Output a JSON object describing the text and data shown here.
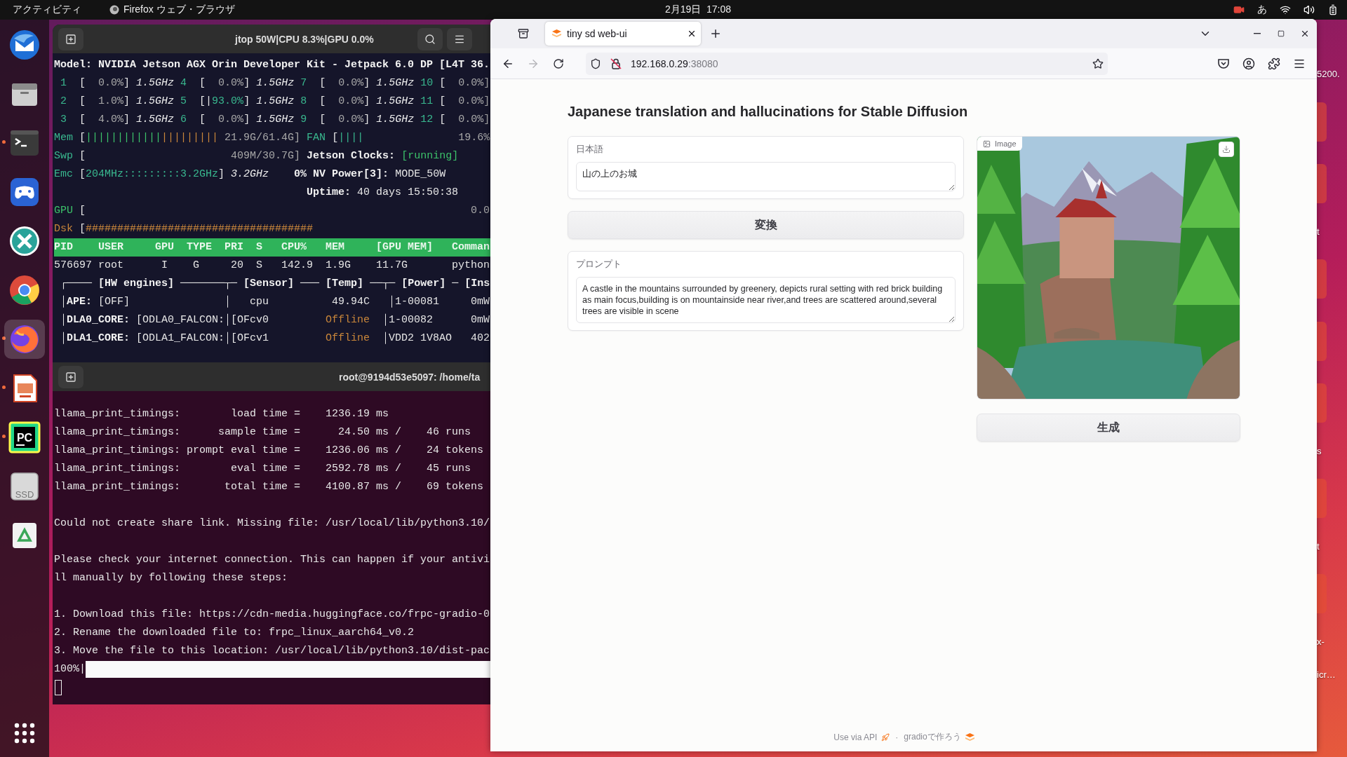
{
  "top_bar": {
    "activities": "アクティビティ",
    "app_name": "Firefox ウェブ・ブラウザ",
    "clock": "2月19日  17:08",
    "input_method": "あ"
  },
  "dock": {
    "items": [
      {
        "kind": "mail",
        "running": false,
        "selected": false
      },
      {
        "kind": "files",
        "running": false,
        "selected": false
      },
      {
        "kind": "terminal",
        "running": true,
        "selected": false
      },
      {
        "kind": "gamepad",
        "running": false,
        "selected": false
      },
      {
        "kind": "remote",
        "running": false,
        "selected": false
      },
      {
        "kind": "chrome",
        "running": false,
        "selected": false
      },
      {
        "kind": "firefox",
        "running": true,
        "selected": true
      },
      {
        "kind": "presentation",
        "running": true,
        "selected": false
      },
      {
        "kind": "ide",
        "label": "PC",
        "running": true,
        "selected": false
      },
      {
        "kind": "drive",
        "label": "SSD",
        "running": false,
        "selected": false
      },
      {
        "kind": "trash",
        "running": false,
        "selected": false
      }
    ]
  },
  "jtop_terminal": {
    "title": "jtop 50W|CPU 8.3%|GPU 0.0%",
    "lines": [
      [
        {
          "text": "Model: NVIDIA Jetson AGX Orin Developer Kit - Jetpack 6.0 DP [L4T 36.",
          "kind": "bold"
        }
      ],
      [
        {
          "text": " 1  ",
          "kind": "label"
        },
        {
          "text": "[  ",
          "kind": "plain"
        },
        {
          "text": "0.0%",
          "kind": "dim"
        },
        {
          "text": "] ",
          "kind": "plain"
        },
        {
          "text": "1.5GHz",
          "kind": "italic"
        },
        {
          "text": " 4  ",
          "kind": "label"
        },
        {
          "text": "[  ",
          "kind": "plain"
        },
        {
          "text": "0.0%",
          "kind": "dim"
        },
        {
          "text": "] ",
          "kind": "plain"
        },
        {
          "text": "1.5GHz",
          "kind": "italic"
        },
        {
          "text": " 7  ",
          "kind": "label"
        },
        {
          "text": "[  ",
          "kind": "plain"
        },
        {
          "text": "0.0%",
          "kind": "dim"
        },
        {
          "text": "] ",
          "kind": "plain"
        },
        {
          "text": "1.5GHz",
          "kind": "italic"
        },
        {
          "text": " 10 ",
          "kind": "label"
        },
        {
          "text": "[  ",
          "kind": "plain"
        },
        {
          "text": "0.0%]",
          "kind": "dim"
        }
      ],
      [
        {
          "text": " 2  ",
          "kind": "label"
        },
        {
          "text": "[  ",
          "kind": "plain"
        },
        {
          "text": "1.0%",
          "kind": "dim"
        },
        {
          "text": "] ",
          "kind": "plain"
        },
        {
          "text": "1.5GHz",
          "kind": "italic"
        },
        {
          "text": " 5  ",
          "kind": "label"
        },
        {
          "text": "[|",
          "kind": "plain"
        },
        {
          "text": "93.0%",
          "kind": "label"
        },
        {
          "text": "] ",
          "kind": "plain"
        },
        {
          "text": "1.5GHz",
          "kind": "italic"
        },
        {
          "text": " 8  ",
          "kind": "label"
        },
        {
          "text": "[  ",
          "kind": "plain"
        },
        {
          "text": "0.0%",
          "kind": "dim"
        },
        {
          "text": "] ",
          "kind": "plain"
        },
        {
          "text": "1.5GHz",
          "kind": "italic"
        },
        {
          "text": " 11 ",
          "kind": "label"
        },
        {
          "text": "[  ",
          "kind": "plain"
        },
        {
          "text": "0.0%]",
          "kind": "dim"
        }
      ],
      [
        {
          "text": " 3  ",
          "kind": "label"
        },
        {
          "text": "[  ",
          "kind": "plain"
        },
        {
          "text": "4.0%",
          "kind": "dim"
        },
        {
          "text": "] ",
          "kind": "plain"
        },
        {
          "text": "1.5GHz",
          "kind": "italic"
        },
        {
          "text": " 6  ",
          "kind": "label"
        },
        {
          "text": "[  ",
          "kind": "plain"
        },
        {
          "text": "0.0%",
          "kind": "dim"
        },
        {
          "text": "] ",
          "kind": "plain"
        },
        {
          "text": "1.5GHz",
          "kind": "italic"
        },
        {
          "text": " 9  ",
          "kind": "label"
        },
        {
          "text": "[  ",
          "kind": "plain"
        },
        {
          "text": "0.0%",
          "kind": "dim"
        },
        {
          "text": "] ",
          "kind": "plain"
        },
        {
          "text": "1.5GHz",
          "kind": "italic"
        },
        {
          "text": " 12 ",
          "kind": "label"
        },
        {
          "text": "[  ",
          "kind": "plain"
        },
        {
          "text": "0.0%]",
          "kind": "dim"
        }
      ],
      [
        {
          "text": "Mem",
          "kind": "label"
        },
        {
          "text": " [",
          "kind": "plain"
        },
        {
          "text": "||||||||||||",
          "kind": "green"
        },
        {
          "text": "|||||||||",
          "kind": "orange"
        },
        {
          "text": " 21.9G/61.4G]",
          "kind": "dim"
        },
        {
          "text": " FAN ",
          "kind": "label"
        },
        {
          "text": "[",
          "kind": "plain"
        },
        {
          "text": "||||",
          "kind": "label"
        },
        {
          "text": "               19.6%",
          "kind": "dim"
        }
      ],
      [
        {
          "text": "Swp",
          "kind": "label"
        },
        {
          "text": " [",
          "kind": "plain"
        },
        {
          "text": "                       409M/30.7G]",
          "kind": "dim"
        },
        {
          "text": " Jetson Clocks: ",
          "kind": "bold"
        },
        {
          "text": "[running]",
          "kind": "green"
        }
      ],
      [
        {
          "text": "Emc",
          "kind": "label"
        },
        {
          "text": " [",
          "kind": "plain"
        },
        {
          "text": "204MHz:::::::::3.2GHz",
          "kind": "label"
        },
        {
          "text": "] ",
          "kind": "plain"
        },
        {
          "text": "3.2GHz",
          "kind": "italic"
        },
        {
          "text": "    0% NV Power[3]: ",
          "kind": "bold"
        },
        {
          "text": "MODE_50W",
          "kind": "plain"
        }
      ],
      [
        {
          "text": "                                        Uptime:",
          "kind": "bold"
        },
        {
          "text": " 40 days 15:50:38",
          "kind": "plain"
        }
      ],
      [
        {
          "text": "GPU",
          "kind": "green"
        },
        {
          "text": " [",
          "kind": "plain"
        },
        {
          "text": "                                                             0.0",
          "kind": "dim"
        }
      ],
      [
        {
          "text": "Dsk",
          "kind": "orange"
        },
        {
          "text": " [",
          "kind": "plain"
        },
        {
          "text": "####################################",
          "kind": "orange"
        }
      ]
    ],
    "table_header": "PID    USER     GPU  TYPE  PRI  S   CPU%   MEM     [GPU MEM]   Comman",
    "table_row": "576697 root      I    G     20  S   142.9  1.9G    11.7G       python",
    "panel_lines": [
      [
        {
          "text": " ┌──── ",
          "kind": "plain"
        },
        {
          "text": "[HW engines]",
          "kind": "bold"
        },
        {
          "text": " ───────┬─ ",
          "kind": "plain"
        },
        {
          "text": "[Sensor]",
          "kind": "bold"
        },
        {
          "text": " ─── ",
          "kind": "plain"
        },
        {
          "text": "[Temp]",
          "kind": "bold"
        },
        {
          "text": " ──┬─ ",
          "kind": "plain"
        },
        {
          "text": "[Power]",
          "kind": "bold"
        },
        {
          "text": " ─ ",
          "kind": "plain"
        },
        {
          "text": "[Ins",
          "kind": "bold"
        }
      ],
      [
        {
          "text": " │",
          "kind": "plain"
        },
        {
          "text": "APE:",
          "kind": "bold"
        },
        {
          "text": " [OFF]               │   cpu          49.94C   │1-00081     0mW",
          "kind": "plain"
        }
      ],
      [
        {
          "text": " │",
          "kind": "plain"
        },
        {
          "text": "DLA0_CORE:",
          "kind": "bold"
        },
        {
          "text": " [ODLA0_FALCON:│[OFcv0         ",
          "kind": "plain"
        },
        {
          "text": "Offline",
          "kind": "orange"
        },
        {
          "text": "  │1-00082      0mW",
          "kind": "plain"
        }
      ],
      [
        {
          "text": " │",
          "kind": "plain"
        },
        {
          "text": "DLA1_CORE:",
          "kind": "bold"
        },
        {
          "text": " [ODLA1_FALCON:│[OFcv1         ",
          "kind": "plain"
        },
        {
          "text": "Offline",
          "kind": "orange"
        },
        {
          "text": "  │VDD2 1V8AO   402",
          "kind": "plain"
        }
      ]
    ]
  },
  "shell_terminal": {
    "title": "root@9194d53e5097: /home/ta",
    "blocks": [
      [
        "llama_print_timings:        load time =    1236.19 ms",
        "llama_print_timings:      sample time =      24.50 ms /    46 runs",
        "llama_print_timings: prompt eval time =    1236.06 ms /    24 tokens",
        "llama_print_timings:        eval time =    2592.78 ms /    45 runs",
        "llama_print_timings:       total time =    4100.87 ms /    69 tokens"
      ],
      [
        "Could not create share link. Missing file: /usr/local/lib/python3.10/"
      ],
      [
        "Please check your internet connection. This can happen if your antivi",
        "ll manually by following these steps:"
      ],
      [
        "1. Download this file: https://cdn-media.huggingface.co/frpc-gradio-0",
        "2. Rename the downloaded file to: frpc_linux_aarch64_v0.2",
        "3. Move the file to this location: /usr/local/lib/python3.10/dist-pac"
      ]
    ],
    "progress": {
      "label": "100%|"
    }
  },
  "browser": {
    "tab": {
      "title": "tiny sd web-ui",
      "selected": true
    },
    "nav_buttons": [
      {
        "kind": "back",
        "disabled": false
      },
      {
        "kind": "forward",
        "disabled": true
      },
      {
        "kind": "reload",
        "disabled": false
      }
    ],
    "url_host": "192.168.0.29",
    "url_port": ":38080",
    "page": {
      "title": "Japanese translation and hallucinations for Stable Diffusion",
      "japanese_field": {
        "label": "日本語",
        "value": "山の上のお城"
      },
      "convert_button": "変換",
      "prompt_field": {
        "label": "プロンプト",
        "value": "A castle in the mountains surrounded by greenery, depicts rural setting with red brick building as main focus,building is on mountainside near river,and trees are scattered around,several trees are visible in scene"
      },
      "image": {
        "label": "Image",
        "kind": "picture"
      },
      "generate_button": "生成",
      "footer": {
        "api_link": "Use via API",
        "separator": "·",
        "gradio_link": "gradioで作ろう"
      }
    }
  },
  "desktop_items": [
    {
      "kind": "label",
      "text": "5200."
    },
    {
      "kind": "tile"
    },
    {
      "kind": "tile"
    },
    {
      "kind": "label",
      "text": "t"
    },
    {
      "kind": "tile"
    },
    {
      "kind": "tile"
    },
    {
      "kind": "tile"
    },
    {
      "kind": "label",
      "text": "s"
    },
    {
      "kind": "tile"
    },
    {
      "kind": "label",
      "text": "t"
    },
    {
      "kind": "tile"
    },
    {
      "kind": "label",
      "text": "x-"
    },
    {
      "kind": "label",
      "text": "icr…"
    }
  ]
}
